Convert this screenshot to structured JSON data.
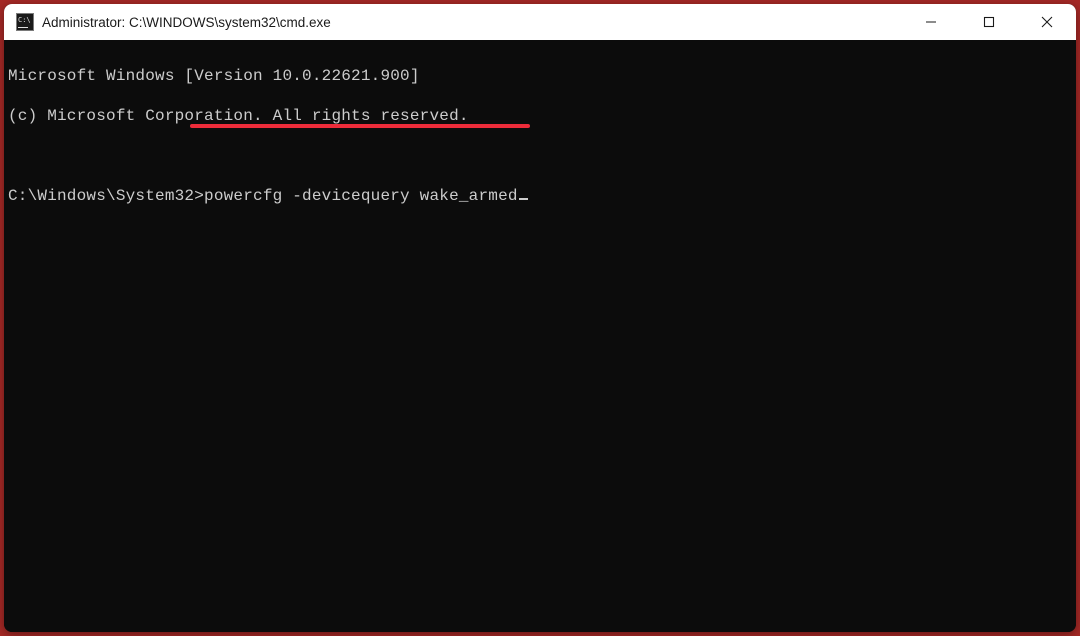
{
  "titlebar": {
    "title": "Administrator: C:\\WINDOWS\\system32\\cmd.exe"
  },
  "terminal": {
    "line1": "Microsoft Windows [Version 10.0.22621.900]",
    "line2": "(c) Microsoft Corporation. All rights reserved.",
    "prompt": "C:\\Windows\\System32>",
    "command": "powercfg -devicequery wake_armed"
  },
  "annotation": {
    "color": "#ed2c3a"
  }
}
